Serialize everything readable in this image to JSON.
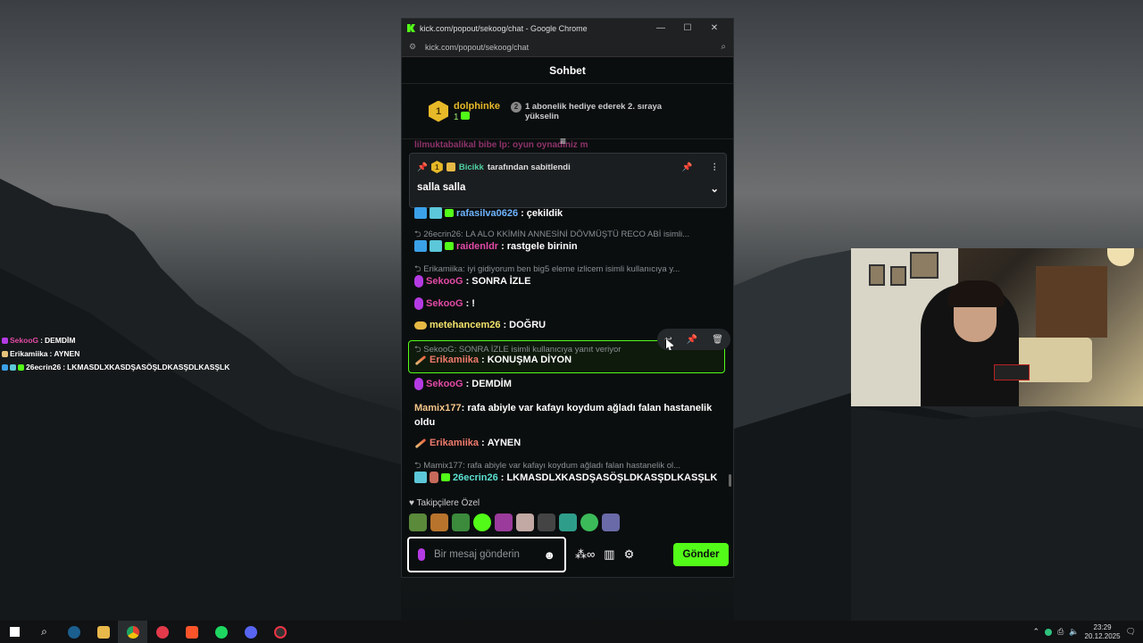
{
  "window": {
    "title": "kick.com/popout/sekoog/chat - Google Chrome",
    "url": "kick.com/popout/sekoog/chat",
    "minimize": "—",
    "maximize": "☐",
    "close": "✕"
  },
  "chat": {
    "header": "Sohbet",
    "leaderboard": {
      "rank": "1",
      "username": "dolphinke",
      "count": "1",
      "next_rank": "2",
      "next_text": "1 abonelik hediye ederek 2. sıraya yükselin"
    },
    "top_partial": "lilmuktabalikal bibe lp: oyun oynadiniz m",
    "pinned": {
      "rank": "1",
      "by": "Bicikk",
      "suffix": "tarafından sabitlendi",
      "message": "salla salla"
    },
    "messages": [
      {
        "user": "rafasilva0626",
        "text": "çekildik"
      },
      {
        "reply": "26ecrin26: LA ALO KKİMİN ANNESİNİ DÖVMÜŞTÜ RECO ABİ isimli..."
      },
      {
        "user": "raidenldr",
        "text": "rastgele birinin"
      },
      {
        "reply": "Erikamiika: iyi gidiyorum ben big5 eleme izlicem isimli kullanıcıya y..."
      },
      {
        "user": "SekooG",
        "text": "SONRA İZLE"
      },
      {
        "user": "SekooG",
        "text": "!"
      },
      {
        "user": "metehancem26",
        "text": "DOĞRU"
      },
      {
        "reply": "SekooG: SONRA İZLE isimli kullanıcıya yanıt veriyor"
      },
      {
        "user": "Erikamiika",
        "text": "KONUŞMA DİYON"
      },
      {
        "user": "SekooG",
        "text": "DEMDİM"
      },
      {
        "user": "Mamix177",
        "text": "rafa abiyle var kafayı koydum ağladı falan hastanelik oldu"
      },
      {
        "user": "Erikamiika",
        "text": "AYNEN"
      },
      {
        "reply": "Mamix177: rafa abiyle var kafayı koydum ağladı falan hastanelik ol..."
      },
      {
        "user": "26ecrin26",
        "text": "LKMASDLXKASDŞASÖŞLDKASŞDLKASŞLK"
      }
    ],
    "followers_label": "Takipçilere Özel",
    "input_placeholder": "Bir mesaj gönderin",
    "send_label": "Gönder"
  },
  "overlay": [
    {
      "user": "SekooG",
      "text": "DEMDİM"
    },
    {
      "user": "Erikamiika",
      "text": "AYNEN"
    },
    {
      "user": "26ecrin26",
      "text": "LKMASDLXKASDŞASÖŞLDKASŞDLKASŞLK"
    }
  ],
  "taskbar": {
    "time": "23:29",
    "date": "20.12.2025"
  },
  "colors": {
    "kick_green": "#53fc18",
    "gold": "#e7b928"
  }
}
